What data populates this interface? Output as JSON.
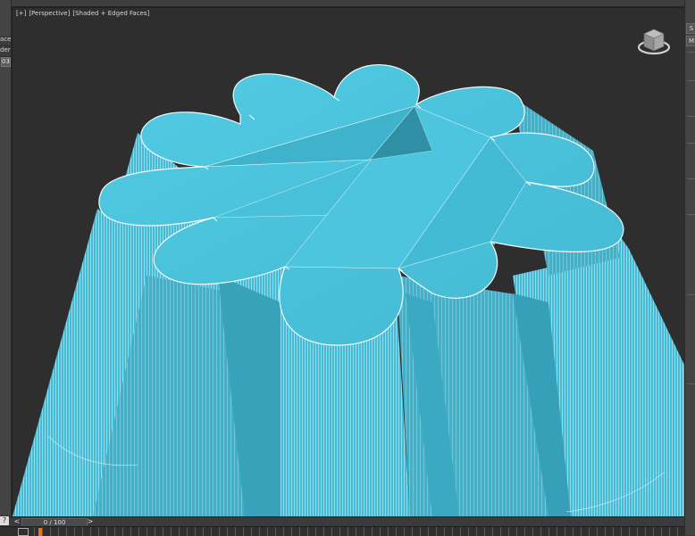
{
  "viewport": {
    "label_parts": [
      "[+]",
      "[Perspective]",
      "[Shaded + Edged Faces]"
    ]
  },
  "left_panel": {
    "labels": [
      "acer",
      "derC",
      "03"
    ]
  },
  "right_panel": {
    "tabs": [
      "S",
      "M"
    ]
  },
  "timeline": {
    "frame_text": "0 / 100",
    "prev_arrow": "<",
    "next_arrow": ">"
  },
  "help_button": "?",
  "colors": {
    "object_fill": "#45bcd6",
    "object_top": "#4cc6df",
    "object_shadow": "#3aa6be",
    "wire": "#e8f6fa",
    "background": "#2e2e2e"
  },
  "icons": {
    "viewcube": "viewcube-icon",
    "track_icon": "filter-icon"
  }
}
